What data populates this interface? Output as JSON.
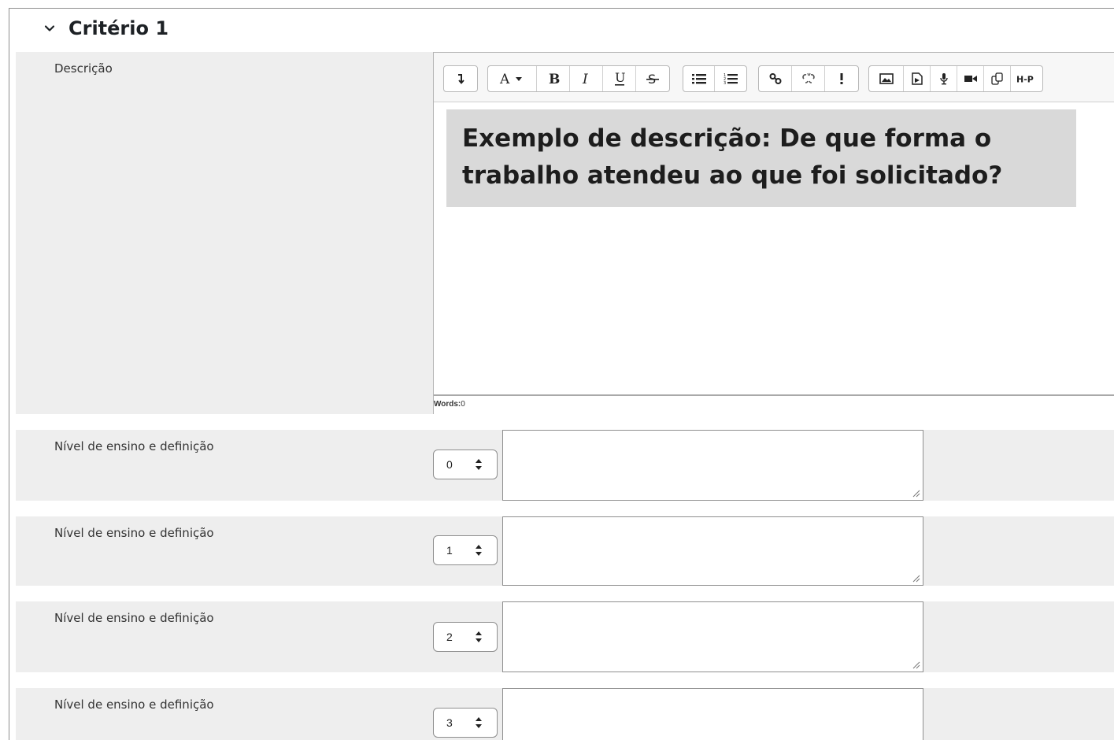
{
  "section": {
    "title": "Critério 1",
    "icon": "chevron-down-icon"
  },
  "description": {
    "label": "Descrição",
    "toolbar": {
      "groups": [
        [
          "collapse-icon"
        ],
        [
          "font-color-icon",
          "bold-icon",
          "italic-icon",
          "underline-icon",
          "strikethrough-icon"
        ],
        [
          "unordered-list-icon",
          "ordered-list-icon"
        ],
        [
          "link-icon",
          "unlink-icon",
          "emoticon-icon"
        ],
        [
          "image-icon",
          "media-icon",
          "record-audio-icon",
          "record-video-icon",
          "manage-files-icon",
          "h5p-icon"
        ]
      ]
    },
    "content_text": "Exemplo de descrição: De que forma o trabalho atendeu ao que foi solicitado?",
    "words_label": "Words:",
    "words_count": "0"
  },
  "levels": [
    {
      "label": "Nível de ensino e definição",
      "value": "0",
      "definition": ""
    },
    {
      "label": "Nível de ensino e definição",
      "value": "1",
      "definition": ""
    },
    {
      "label": "Nível de ensino e definição",
      "value": "2",
      "definition": ""
    },
    {
      "label": "Nível de ensino e definição",
      "value": "3",
      "definition": ""
    }
  ]
}
